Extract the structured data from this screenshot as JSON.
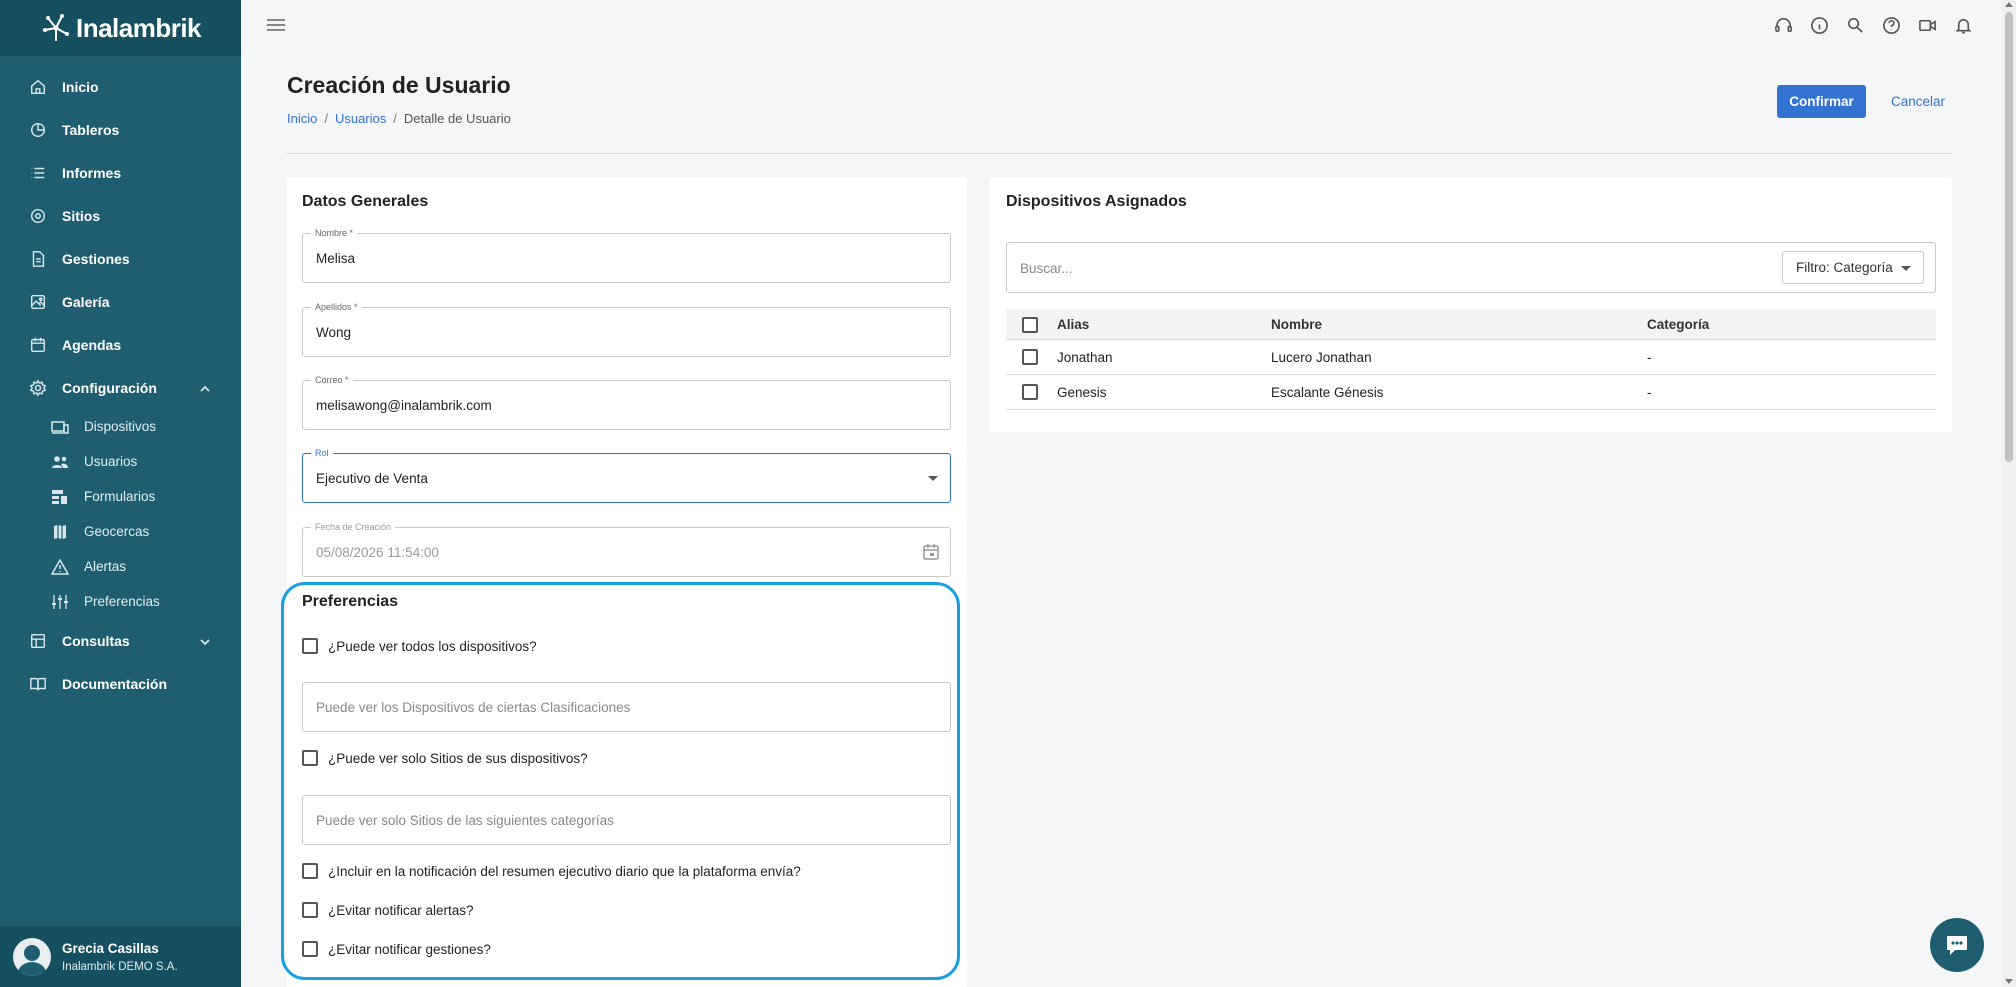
{
  "brand": {
    "name": "Inalambrik"
  },
  "sidebar": {
    "items": [
      {
        "label": "Inicio",
        "icon": "home-icon"
      },
      {
        "label": "Tableros",
        "icon": "pie-chart-icon"
      },
      {
        "label": "Informes",
        "icon": "list-icon"
      },
      {
        "label": "Sitios",
        "icon": "map-pin-icon"
      },
      {
        "label": "Gestiones",
        "icon": "document-icon"
      },
      {
        "label": "Galería",
        "icon": "image-icon"
      },
      {
        "label": "Agendas",
        "icon": "calendar-icon"
      },
      {
        "label": "Configuración",
        "icon": "gear-icon"
      }
    ],
    "config_sub": [
      {
        "label": "Dispositivos",
        "icon": "devices-icon"
      },
      {
        "label": "Usuarios",
        "icon": "users-icon"
      },
      {
        "label": "Formularios",
        "icon": "forms-icon"
      },
      {
        "label": "Geocercas",
        "icon": "map-icon"
      },
      {
        "label": "Alertas",
        "icon": "warning-icon"
      },
      {
        "label": "Preferencias",
        "icon": "sliders-icon"
      }
    ],
    "after": [
      {
        "label": "Consultas",
        "icon": "table-icon"
      },
      {
        "label": "Documentación",
        "icon": "book-icon"
      }
    ],
    "user": {
      "name": "Grecia Casillas",
      "org": "Inalambrik DEMO S.A."
    }
  },
  "header": {
    "title": "Creación de Usuario",
    "breadcrumb": [
      "Inicio",
      "Usuarios",
      "Detalle de Usuario"
    ],
    "confirm_label": "Confirmar",
    "cancel_label": "Cancelar"
  },
  "general": {
    "title": "Datos Generales",
    "nombre_label": "Nombre *",
    "nombre_value": "Melisa",
    "apellidos_label": "Apellidos *",
    "apellidos_value": "Wong",
    "correo_label": "Correo *",
    "correo_value": "melisawong@inalambrik.com",
    "rol_label": "Rol",
    "rol_value": "Ejecutivo de Venta",
    "fecha_label": "Fecha de Creación",
    "fecha_value": "05/08/2026 11:54:00"
  },
  "preferences": {
    "title": "Preferencias",
    "ver_todos": "¿Puede ver todos los dispositivos?",
    "clasificaciones_placeholder": "Puede ver los Dispositivos de ciertas Clasificaciones",
    "solo_sitios": "¿Puede ver solo Sitios de sus dispositivos?",
    "categorias_placeholder": "Puede ver solo Sitios de las siguientes categorías",
    "incluir_resumen": "¿Incluir en la notificación del resumen ejecutivo diario que la plataforma envía?",
    "evitar_alertas": "¿Evitar notificar alertas?",
    "evitar_gestiones": "¿Evitar notificar gestiones?"
  },
  "devices": {
    "title": "Dispositivos Asignados",
    "search_placeholder": "Buscar...",
    "filter_label": "Filtro: Categoría",
    "columns": [
      "Alias",
      "Nombre",
      "Categoría"
    ],
    "rows": [
      {
        "alias": "Jonathan",
        "nombre": "Lucero Jonathan",
        "categoria": "-"
      },
      {
        "alias": "Genesis",
        "nombre": "Escalante Génesis",
        "categoria": "-"
      }
    ]
  },
  "colors": {
    "sidebar": "#1f5e70",
    "accent": "#3273d1",
    "highlight": "#1a9fe0"
  }
}
